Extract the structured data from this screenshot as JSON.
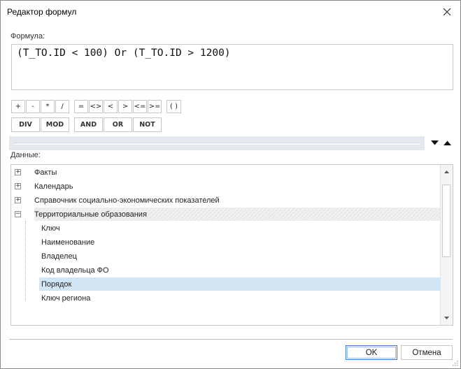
{
  "window": {
    "title": "Редактор формул"
  },
  "formula": {
    "label": "Формула:",
    "value": "(T_TO.ID < 100) Or (T_TO.ID > 1200)"
  },
  "operators": [
    "+",
    "-",
    "*",
    "/",
    "=",
    "<>",
    "<",
    ">",
    "<=",
    ">=",
    "( )"
  ],
  "keywords": [
    "DIV",
    "MOD",
    "AND",
    "OR",
    "NOT"
  ],
  "data_panel": {
    "label": "Данные:",
    "tree": [
      {
        "label": "Факты",
        "expander": "+"
      },
      {
        "label": "Календарь",
        "expander": "+"
      },
      {
        "label": "Справочник социально-экономических показателей",
        "expander": "+"
      },
      {
        "label": "Территориальные образования",
        "expander": "−"
      },
      {
        "label": "Ключ"
      },
      {
        "label": "Наименование"
      },
      {
        "label": "Владелец"
      },
      {
        "label": "Код владельца ФО"
      },
      {
        "label": "Порядок",
        "selected": true
      },
      {
        "label": "Ключ региона"
      }
    ]
  },
  "footer": {
    "ok_label": "OK",
    "cancel_label": "Отмена"
  },
  "colors": {
    "selection": "#d2e5f5",
    "default_button_border": "#3b79c7",
    "splitter": "#e4e9f0"
  }
}
